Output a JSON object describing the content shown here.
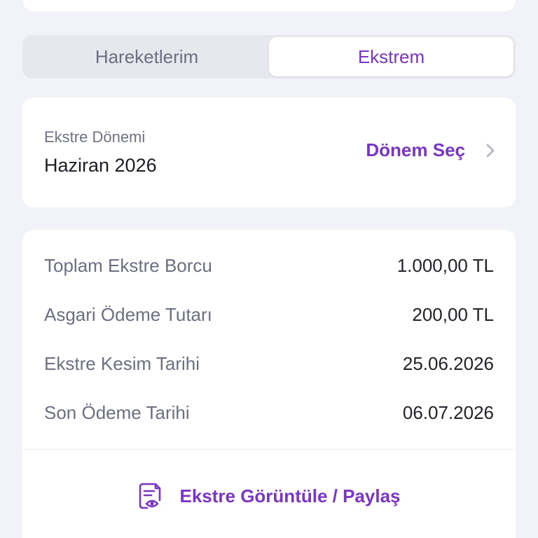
{
  "tabs": [
    {
      "label": "Hareketlerim",
      "active": false
    },
    {
      "label": "Ekstrem",
      "active": true
    }
  ],
  "period": {
    "label": "Ekstre Dönemi",
    "value": "Haziran 2026",
    "select_label": "Dönem Seç"
  },
  "summary": {
    "rows": [
      {
        "label": "Toplam Ekstre Borcu",
        "value": "1.000,00 TL"
      },
      {
        "label": "Asgari Ödeme Tutarı",
        "value": "200,00 TL"
      },
      {
        "label": "Ekstre Kesim Tarihi",
        "value": "25.06.2026"
      },
      {
        "label": "Son Ödeme Tarihi",
        "value": "06.07.2026"
      }
    ],
    "action_label": "Ekstre Görüntüle / Paylaş",
    "action_icon": "statement-view-icon"
  },
  "colors": {
    "accent": "#7a35c5",
    "background": "#f2f3f8",
    "card": "#ffffff"
  }
}
